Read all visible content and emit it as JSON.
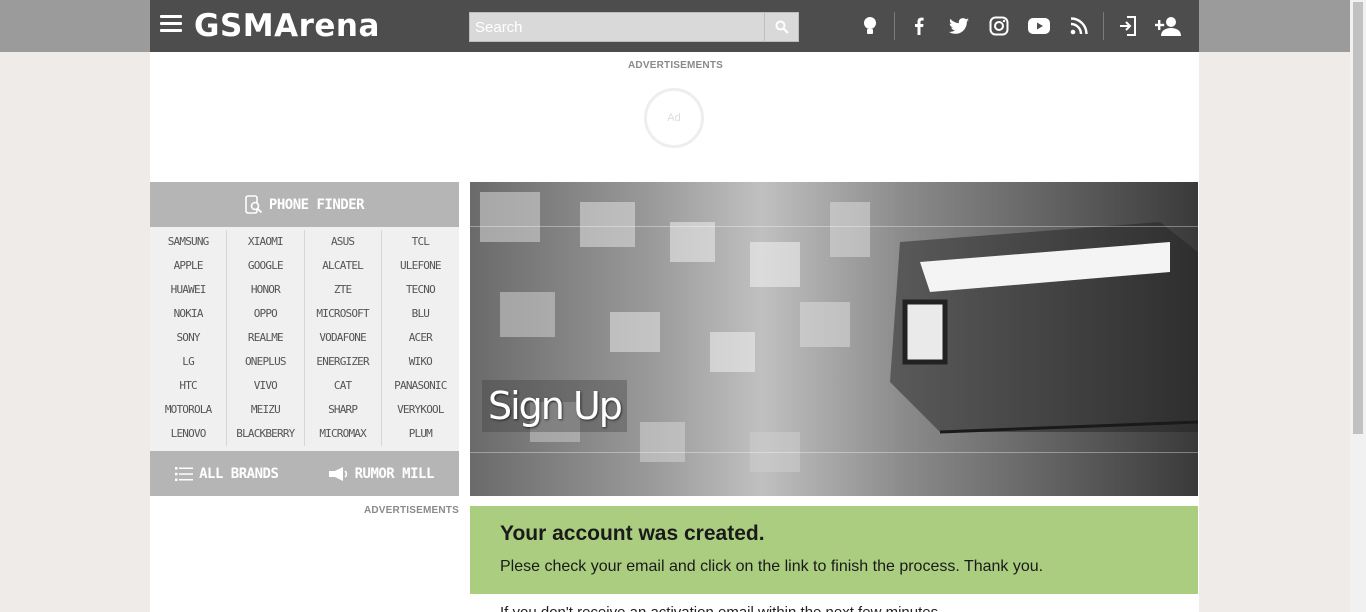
{
  "header": {
    "logo": "GSMArena",
    "search_placeholder": "Search",
    "icons": [
      "menu-icon",
      "search-icon",
      "tip-icon",
      "facebook-icon",
      "twitter-icon",
      "instagram-icon",
      "youtube-icon",
      "rss-icon",
      "login-icon",
      "signup-icon"
    ],
    "colors": {
      "bar": "#4d4d4d",
      "outer": "#9b9b9b"
    }
  },
  "ads": {
    "top_label": "ADVERTISEMENTS",
    "top_placeholder": "Ad",
    "side_label": "ADVERTISEMENTS"
  },
  "phone_finder": {
    "title": "PHONE FINDER",
    "columns": [
      [
        "SAMSUNG",
        "APPLE",
        "HUAWEI",
        "NOKIA",
        "SONY",
        "LG",
        "HTC",
        "MOTOROLA",
        "LENOVO"
      ],
      [
        "XIAOMI",
        "GOOGLE",
        "HONOR",
        "OPPO",
        "REALME",
        "ONEPLUS",
        "VIVO",
        "MEIZU",
        "BLACKBERRY"
      ],
      [
        "ASUS",
        "ALCATEL",
        "ZTE",
        "MICROSOFT",
        "VODAFONE",
        "ENERGIZER",
        "CAT",
        "SHARP",
        "MICROMAX"
      ],
      [
        "TCL",
        "ULEFONE",
        "TECNO",
        "BLU",
        "ACER",
        "WIKO",
        "PANASONIC",
        "VERYKOOL",
        "PLUM"
      ]
    ],
    "all_brands": "ALL BRANDS",
    "rumor_mill": "RUMOR MILL"
  },
  "hero": {
    "title": "Sign Up"
  },
  "message": {
    "title": "Your account was created.",
    "body": "Plese check your email and click on the link to finish the process. Thank you.",
    "color": "#abcd80"
  },
  "below_text": "If you don't receive an activation email within the next few minutes,"
}
